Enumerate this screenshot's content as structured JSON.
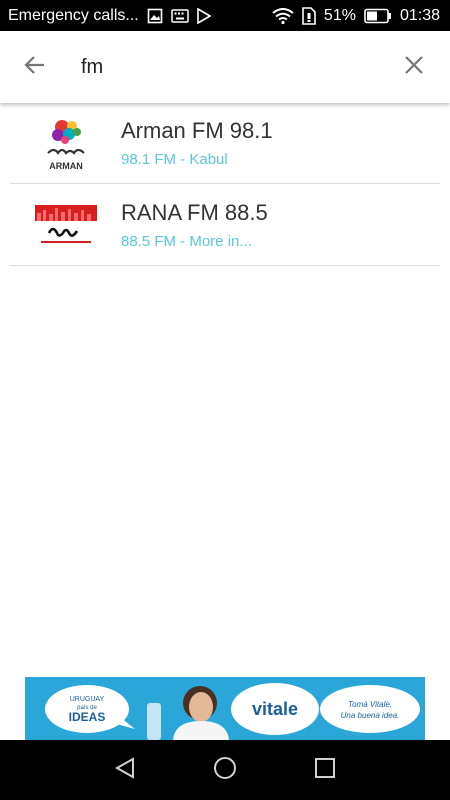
{
  "status_bar": {
    "notification_text": "Emergency calls...",
    "battery_percent": "51%",
    "time": "01:38",
    "icons": [
      "image-icon",
      "keyboard-icon",
      "play-store-icon",
      "wifi-icon",
      "sim-icon",
      "battery-icon"
    ]
  },
  "search": {
    "query": "fm",
    "back_icon": "arrow-back-icon",
    "clear_icon": "close-icon"
  },
  "results": [
    {
      "name": "Arman FM 98.1",
      "subtitle": "98.1 FM - Kabul",
      "logo": "arman-logo"
    },
    {
      "name": "RANA FM 88.5",
      "subtitle": "88.5 FM - More in...",
      "logo": "rana-logo"
    }
  ],
  "ad": {
    "brand": "vitale",
    "left_line1": "URUGUAY",
    "left_line2": "país de",
    "left_line3": "IDEAS",
    "tagline_line1": "Tomá Vitale.",
    "tagline_line2": "Una buena idea."
  },
  "logos": {
    "arman_text": "ARMAN"
  },
  "colors": {
    "accent_subtitle": "#5ac8d8",
    "ad_background": "#2aa6d8",
    "rana_red": "#d81e1e"
  },
  "nav_bar": {
    "icons": [
      "back-triangle-icon",
      "home-circle-icon",
      "recents-square-icon"
    ]
  }
}
